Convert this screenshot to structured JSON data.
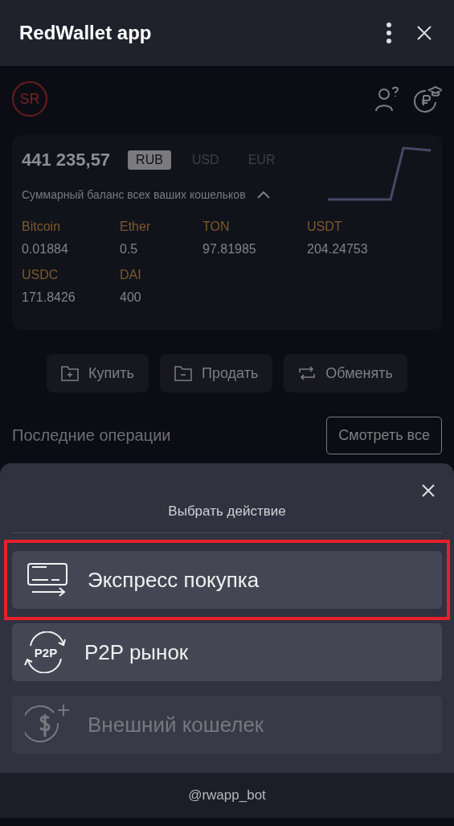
{
  "window": {
    "title": "RedWallet app"
  },
  "profile": {
    "avatar": "SR"
  },
  "balance": {
    "amount": "441 235,57",
    "caption": "Суммарный баланс всех ваших кошельков",
    "expanded": true,
    "currencies": [
      {
        "label": "RUB",
        "selected": true
      },
      {
        "label": "USD",
        "selected": false
      },
      {
        "label": "EUR",
        "selected": false
      }
    ],
    "assets": [
      {
        "name": "Bitcoin",
        "amount": "0.01884"
      },
      {
        "name": "Ether",
        "amount": "0.5"
      },
      {
        "name": "TON",
        "amount": "97.81985"
      },
      {
        "name": "USDT",
        "amount": "204.24753"
      },
      {
        "name": "USDC",
        "amount": "171.8426"
      },
      {
        "name": "DAI",
        "amount": "400"
      }
    ]
  },
  "actions": [
    {
      "kind": "buy",
      "label": "Купить"
    },
    {
      "kind": "sell",
      "label": "Продать"
    },
    {
      "kind": "exchange",
      "label": "Обменять"
    }
  ],
  "recent": {
    "title": "Последние операции",
    "button": "Смотреть все"
  },
  "sheet": {
    "title": "Выбрать действие",
    "options": [
      {
        "kind": "card",
        "label": "Экспресс покупка",
        "highlighted": true,
        "disabled": false
      },
      {
        "kind": "p2p",
        "icon_text": "P2P",
        "label": "P2P рынок",
        "highlighted": false,
        "disabled": false
      },
      {
        "kind": "wallet",
        "label": "Внешний кошелек",
        "highlighted": false,
        "disabled": true
      }
    ]
  },
  "footer": "@rwapp_bot"
}
